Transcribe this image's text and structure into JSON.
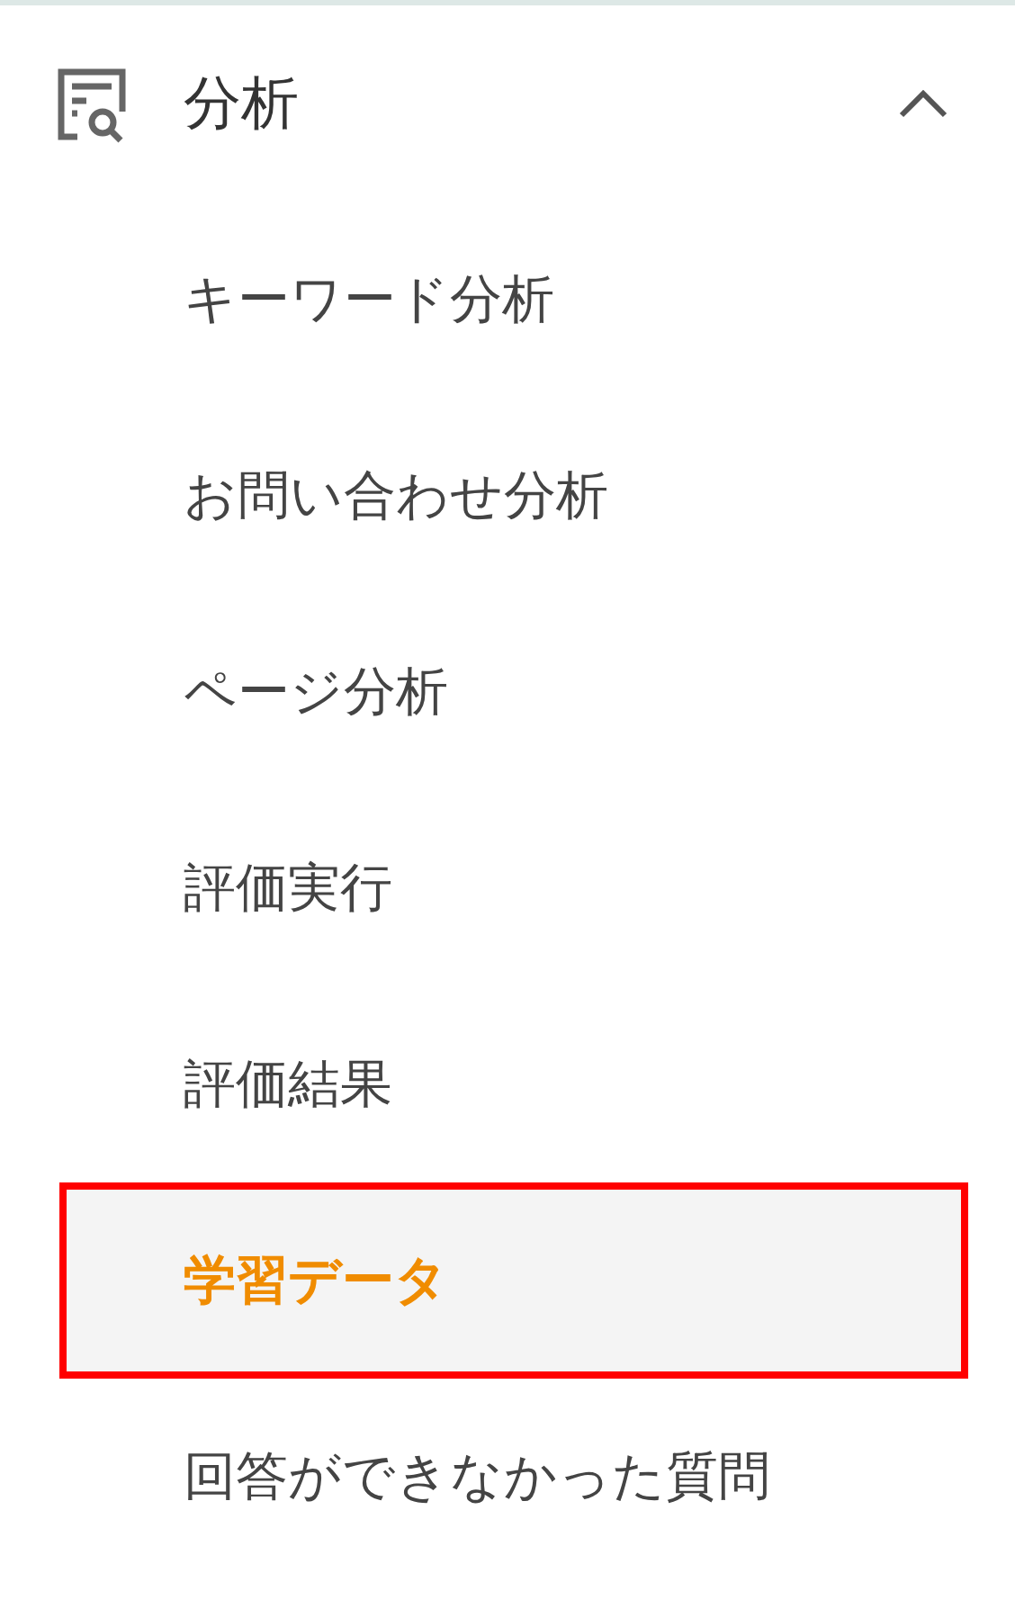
{
  "section": {
    "title": "分析",
    "expanded": true
  },
  "items": [
    {
      "label": "キーワード分析",
      "selected": false,
      "highlighted": false
    },
    {
      "label": "お問い合わせ分析",
      "selected": false,
      "highlighted": false
    },
    {
      "label": "ページ分析",
      "selected": false,
      "highlighted": false
    },
    {
      "label": "評価実行",
      "selected": false,
      "highlighted": false
    },
    {
      "label": "評価結果",
      "selected": false,
      "highlighted": false
    },
    {
      "label": "学習データ",
      "selected": true,
      "highlighted": true
    },
    {
      "label": "回答ができなかった質問",
      "selected": false,
      "highlighted": false
    }
  ]
}
